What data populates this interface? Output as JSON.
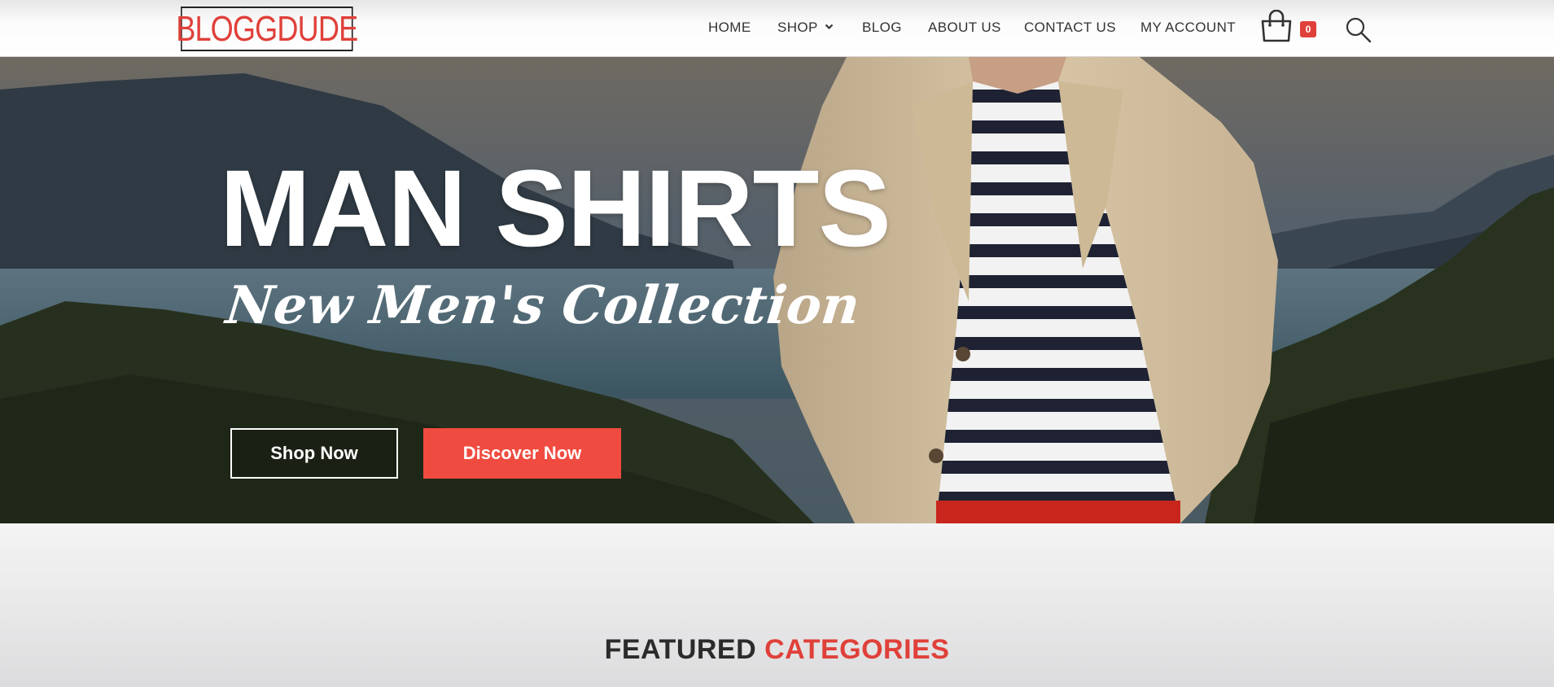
{
  "header": {
    "logo_text": "BLOGGDUDE",
    "nav": [
      {
        "label": "HOME"
      },
      {
        "label": "SHOP"
      },
      {
        "label": "BLOG"
      },
      {
        "label": "ABOUT US"
      },
      {
        "label": "CONTACT US"
      },
      {
        "label": "MY ACCOUNT"
      }
    ],
    "cart_count": "0",
    "cart_icon": "shopping-bag-icon",
    "search_icon": "search-icon"
  },
  "hero": {
    "title": "MAN SHIRTS",
    "subtitle": "New Men's Collection",
    "shop_now_label": "Shop Now",
    "discover_now_label": "Discover Now"
  },
  "featured": {
    "word1": "FEATURED",
    "word2": "CATEGORIES"
  },
  "colors": {
    "accent": "#e0403a",
    "button_red": "#f04b40",
    "text_dark": "#333333"
  }
}
